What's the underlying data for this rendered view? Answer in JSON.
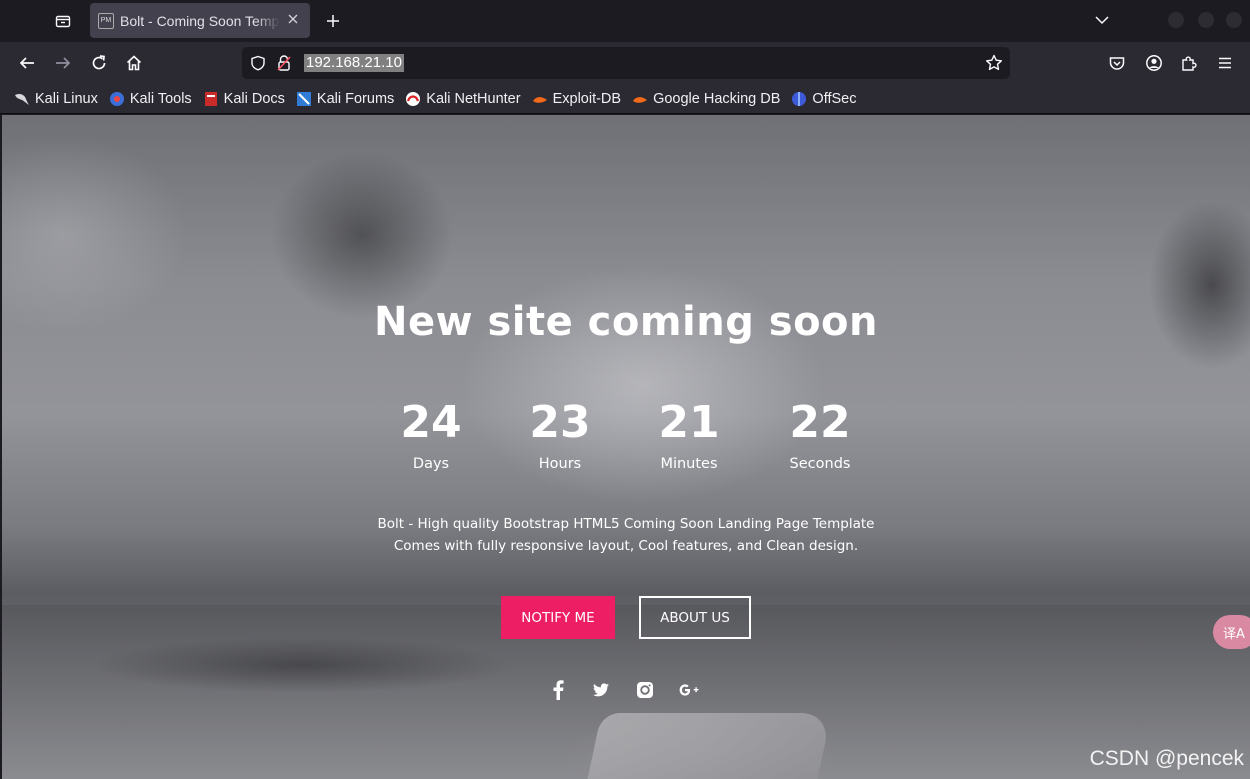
{
  "browser": {
    "tab": {
      "favicon_text": "PM",
      "title": "Bolt - Coming Soon Template"
    },
    "url": "192.168.21.10",
    "bookmarks": [
      {
        "label": "Kali Linux",
        "icon": "kali-dragon-icon"
      },
      {
        "label": "Kali Tools",
        "icon": "kali-tools-icon"
      },
      {
        "label": "Kali Docs",
        "icon": "kali-docs-icon"
      },
      {
        "label": "Kali Forums",
        "icon": "kali-forums-icon"
      },
      {
        "label": "Kali NetHunter",
        "icon": "nethunter-icon"
      },
      {
        "label": "Exploit-DB",
        "icon": "exploit-db-icon"
      },
      {
        "label": "Google Hacking DB",
        "icon": "ghdb-icon"
      },
      {
        "label": "OffSec",
        "icon": "offsec-icon"
      }
    ]
  },
  "page": {
    "title": "New site coming soon",
    "countdown": [
      {
        "value": "24",
        "label": "Days"
      },
      {
        "value": "23",
        "label": "Hours"
      },
      {
        "value": "21",
        "label": "Minutes"
      },
      {
        "value": "22",
        "label": "Seconds"
      }
    ],
    "description_line1": "Bolt - High quality Bootstrap HTML5 Coming Soon Landing Page Template",
    "description_line2": "Comes with fully responsive layout, Cool features, and Clean design.",
    "notify_label": "NOTIFY ME",
    "about_label": "ABOUT US",
    "social": [
      "facebook-icon",
      "twitter-icon",
      "instagram-icon",
      "google-plus-icon"
    ],
    "accent_color": "#ed1e63"
  },
  "overlay": {
    "translate_label": "译A",
    "watermark": "CSDN @pencek"
  }
}
